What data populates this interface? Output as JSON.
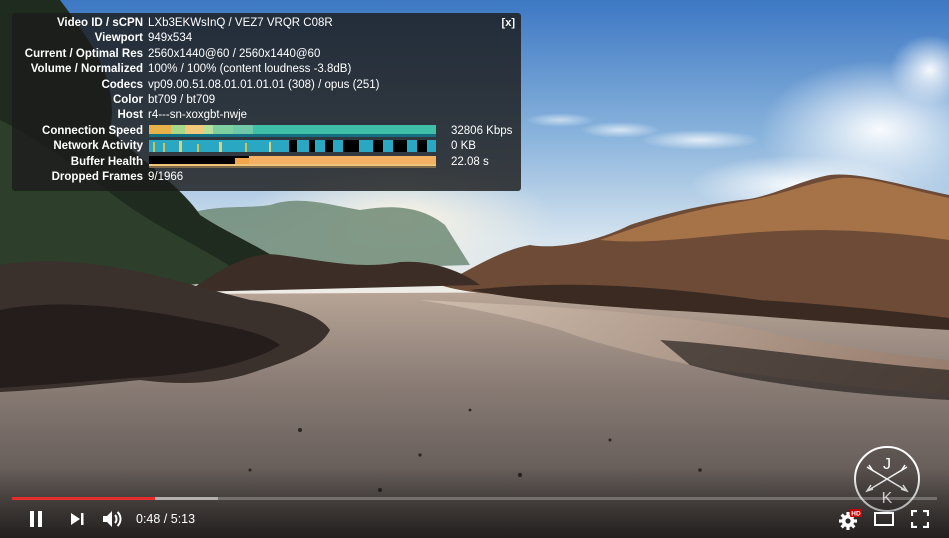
{
  "stats": {
    "close_label": "[x]",
    "rows": [
      {
        "label": "Video ID / sCPN",
        "value": "LXb3EKWsInQ / VEZ7 VRQR C08R"
      },
      {
        "label": "Viewport",
        "value": "949x534"
      },
      {
        "label": "Current / Optimal Res",
        "value": "2560x1440@60 / 2560x1440@60"
      },
      {
        "label": "Volume / Normalized",
        "value": "100% / 100% (content loudness -3.8dB)"
      },
      {
        "label": "Codecs",
        "value": "vp09.00.51.08.01.01.01.01 (308) / opus (251)"
      },
      {
        "label": "Color",
        "value": "bt709 / bt709"
      },
      {
        "label": "Host",
        "value": "r4---sn-xoxgbt-nwje"
      }
    ],
    "graphs": [
      {
        "label": "Connection Speed",
        "value": "32806 Kbps"
      },
      {
        "label": "Network Activity",
        "value": "0 KB"
      },
      {
        "label": "Buffer Health",
        "value": "22.08 s"
      }
    ],
    "dropped": {
      "label": "Dropped Frames",
      "value": "9/1966"
    }
  },
  "controls": {
    "time_display": "0:48 / 5:13",
    "progress_played": 0.155,
    "progress_buffered": 0.223,
    "quality_badge": "HD"
  },
  "watermark": {
    "top_letter": "J",
    "bottom_letter": "K"
  },
  "colors": {
    "progress_red": "#e52c2c",
    "hd_badge": "#cc0000"
  }
}
